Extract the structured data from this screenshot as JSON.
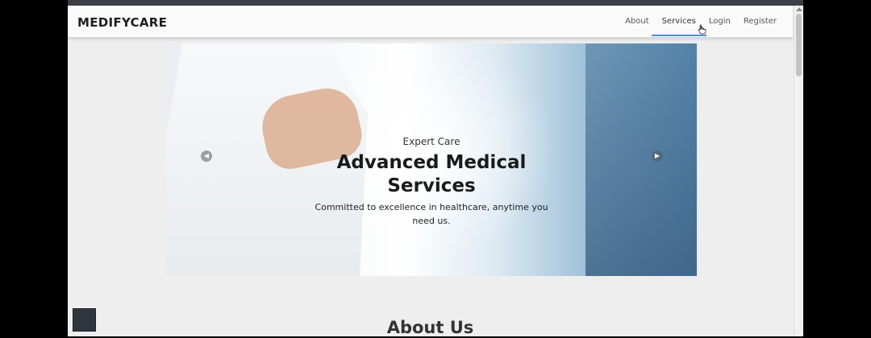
{
  "navbar": {
    "brand": "MEDIFYCARE",
    "links": [
      {
        "label": "About"
      },
      {
        "label": "Services"
      },
      {
        "label": "Login"
      },
      {
        "label": "Register"
      }
    ],
    "active_index": 1
  },
  "hero": {
    "eyebrow": "Expert Care",
    "headline_line1": "Advanced Medical",
    "headline_line2": "Services",
    "subtext": "Committed to excellence in healthcare, anytime you need us.",
    "prev_icon": "chevron-left-icon",
    "next_icon": "chevron-right-icon"
  },
  "about": {
    "title": "About Us"
  },
  "colors": {
    "accent": "#4a90d9",
    "nav_text": "#555555",
    "page_bg": "#eeeeee",
    "float_box": "#2f3640"
  }
}
